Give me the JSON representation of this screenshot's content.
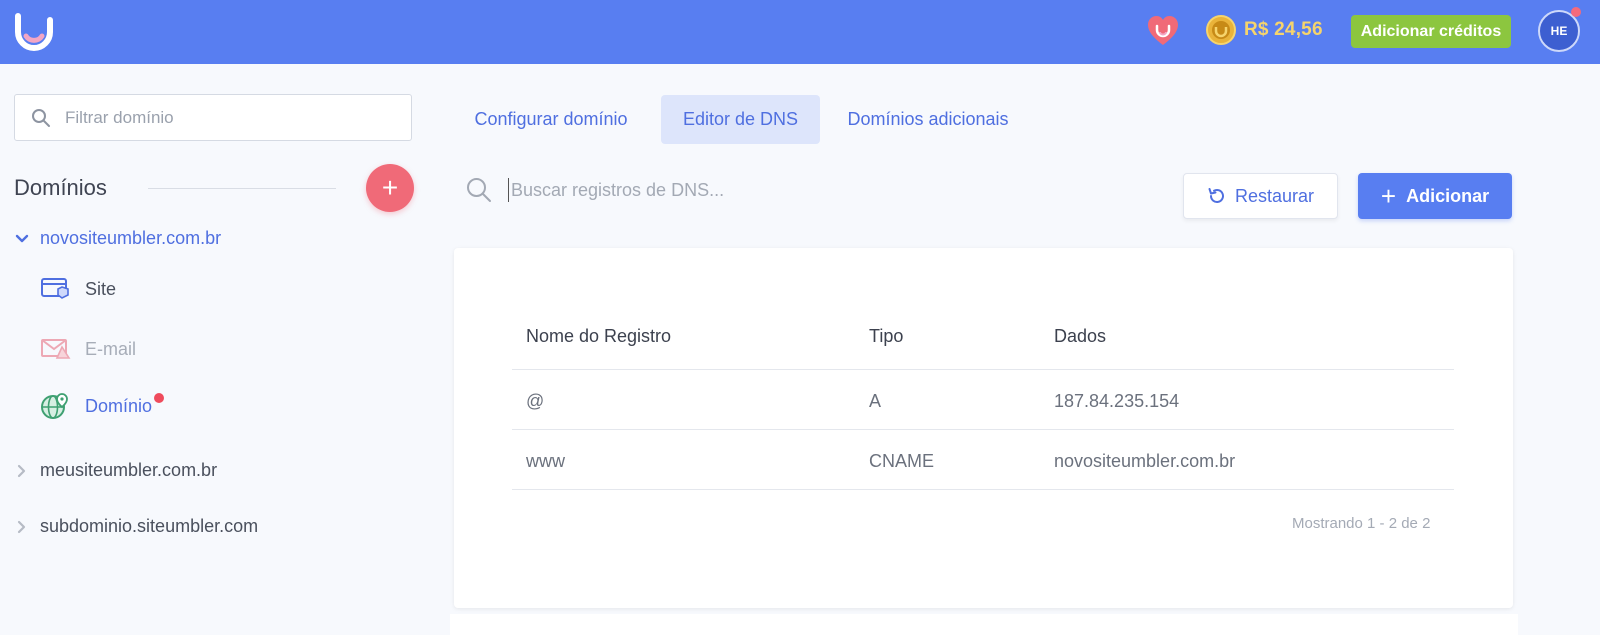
{
  "header": {
    "balance": "R$ 24,56",
    "add_credits_label": "Adicionar créditos",
    "avatar_initials": "HE",
    "colors": {
      "bar": "#587ef1",
      "credits_button": "#8cc63f",
      "balance_text": "#f6d46c"
    },
    "icons": [
      "umbler-logo-icon",
      "heart-icon",
      "coin-icon"
    ]
  },
  "sidebar": {
    "filter_placeholder": "Filtrar domínio",
    "title": "Domínios",
    "add_icon": "plus-icon",
    "domains": [
      {
        "name": "novositeumbler.com.br",
        "expanded": true,
        "children": [
          {
            "label": "Site",
            "icon": "site-browser-icon"
          },
          {
            "label": "E-mail",
            "icon": "mail-icon"
          },
          {
            "label": "Domínio",
            "icon": "globe-pin-icon",
            "active": true,
            "notification": true
          }
        ]
      },
      {
        "name": "meusiteumbler.com.br",
        "expanded": false
      },
      {
        "name": "subdominio.siteumbler.com",
        "expanded": false
      }
    ]
  },
  "tabs": [
    {
      "label": "Configurar domínio",
      "active": false
    },
    {
      "label": "Editor de DNS",
      "active": true
    },
    {
      "label": "Domínios adicionais",
      "active": false
    }
  ],
  "dns": {
    "search_placeholder": "Buscar registros de DNS...",
    "restore_label": "Restaurar",
    "add_label": "Adicionar",
    "table": {
      "columns": [
        "Nome do Registro",
        "Tipo",
        "Dados"
      ],
      "rows": [
        [
          "@",
          "A",
          "187.84.235.154"
        ],
        [
          "www",
          "CNAME",
          "novositeumbler.com.br"
        ]
      ],
      "pagination": "Mostrando 1 - 2 de 2"
    }
  }
}
